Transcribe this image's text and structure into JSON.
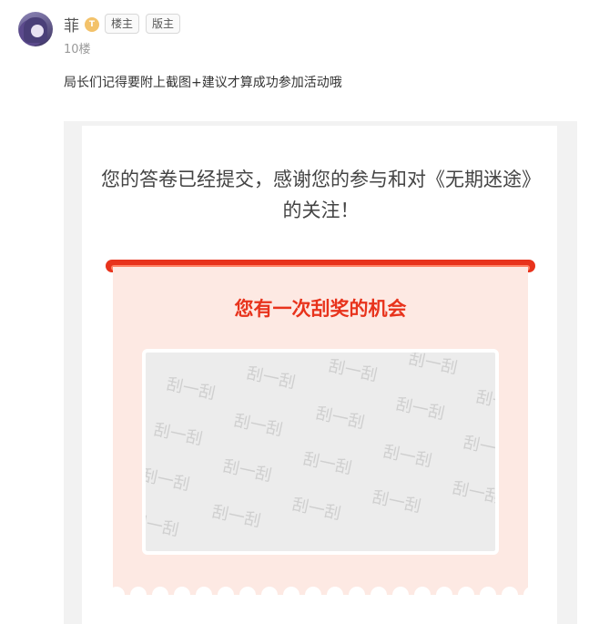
{
  "post": {
    "username": "菲",
    "level_badge": "T",
    "tags": [
      "楼主",
      "版主"
    ],
    "floor": "10楼",
    "message": "局长们记得要附上截图+建议才算成功参加活动哦"
  },
  "screenshot": {
    "submit_message": "您的答卷已经提交，感谢您的参与和对《无期迷途》的关注！",
    "ticket_title": "您有一次刮奖的机会",
    "scratch_label": "刮一刮"
  },
  "colors": {
    "accent_red": "#e8331c",
    "ticket_bg": "#fde9e3",
    "scratch_bg": "#ececec"
  }
}
